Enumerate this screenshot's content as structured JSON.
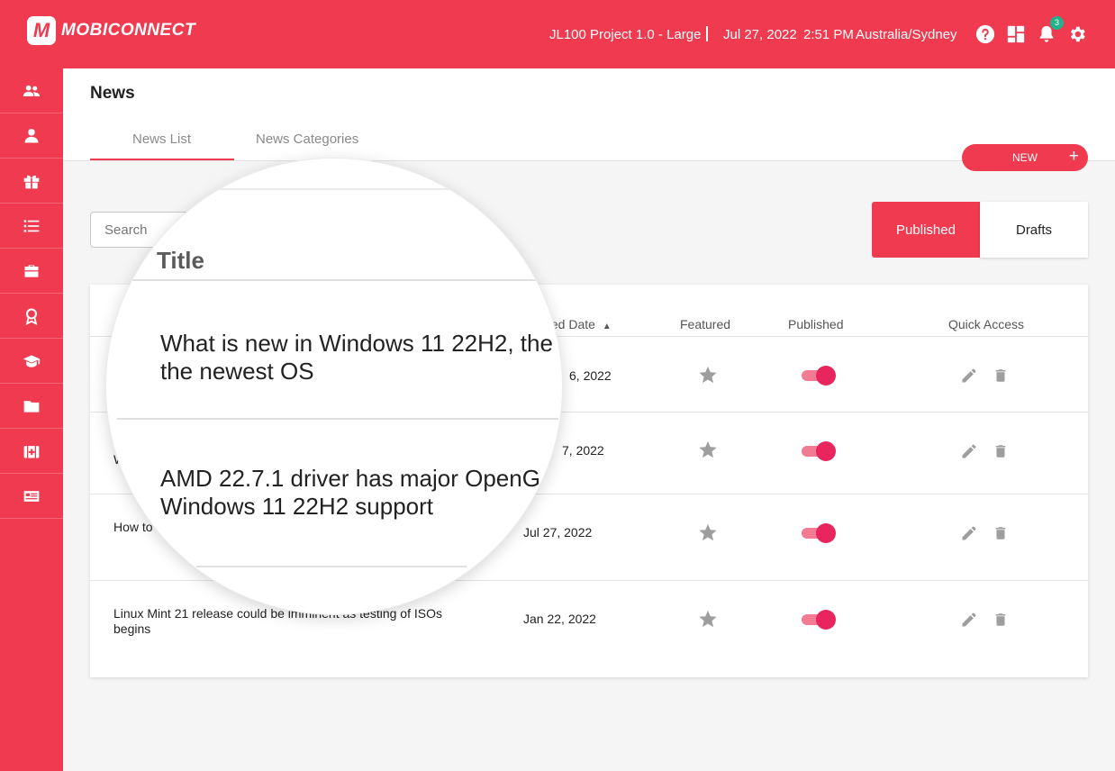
{
  "app": {
    "brand": "MOBICONNECT",
    "brand_mark": "M",
    "project": "JL100 Project 1.0 - Large",
    "date": "Jul 27, 2022",
    "time": "2:51 PM",
    "timezone": "Australia/Sydney",
    "notification_count": "3",
    "accent_color": "#ef3a4f"
  },
  "sidebar": {
    "items": [
      {
        "icon": "users-icon"
      },
      {
        "icon": "user-icon"
      },
      {
        "icon": "gift-icon"
      },
      {
        "icon": "list-icon"
      },
      {
        "icon": "briefcase-icon"
      },
      {
        "icon": "award-icon"
      },
      {
        "icon": "graduation-cap-icon"
      },
      {
        "icon": "folder-icon"
      },
      {
        "icon": "medical-kit-icon"
      },
      {
        "icon": "news-icon"
      }
    ]
  },
  "page": {
    "title": "News",
    "tabs": [
      "News List",
      "News Categories"
    ],
    "active_tab": "News List",
    "new_button": "NEW",
    "new_button_icon": "+"
  },
  "filters": {
    "search_placeholder": "Search",
    "segments": [
      "Published",
      "Drafts"
    ],
    "active_segment": "Published"
  },
  "table": {
    "columns": {
      "created": "ted Date",
      "featured": "Featured",
      "published": "Published",
      "quick_access": "Quick Access"
    },
    "sort_indicator": "▲",
    "rows": [
      {
        "title_visible": "",
        "date": "6, 2022",
        "featured": false,
        "published": true
      },
      {
        "title_visible": "W",
        "date": "7, 2022",
        "featured": false,
        "published": true
      },
      {
        "title_visible": "How to",
        "date": "Jul 27, 2022",
        "featured": false,
        "published": true
      },
      {
        "title_visible": "Linux Mint 21 release could be imminent as testing of ISOs begins",
        "date": "Jan 22, 2022",
        "featured": false,
        "published": true
      }
    ]
  },
  "magnifier": {
    "header": "Title",
    "rows": [
      {
        "line1": "What is new in Windows 11 22H2, the",
        "line2": "the newest OS"
      },
      {
        "line1": "AMD 22.7.1 driver has major OpenG",
        "line2": "Windows 11 22H2 support"
      }
    ]
  }
}
